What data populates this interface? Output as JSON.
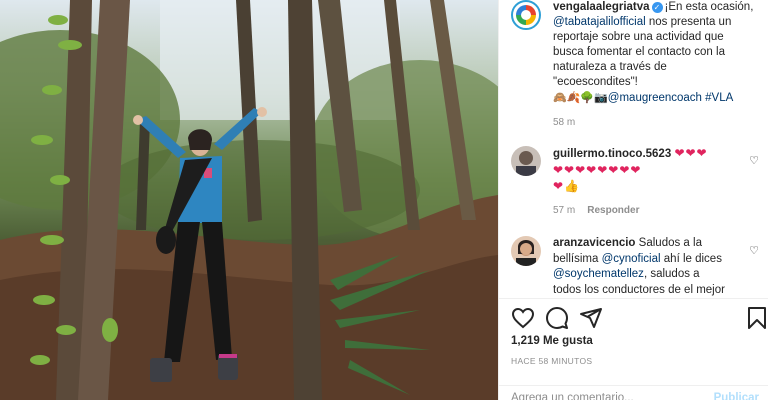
{
  "post": {
    "username": "vengalaalegriatva",
    "caption_lines": [
      "¡En esta ocasión,",
      "nos presenta un",
      "reportaje sobre una actividad que",
      "busca fomentar el contacto con la",
      "naturaleza a través de",
      "\"ecoescondites\"!"
    ],
    "caption_mention": "@tabatajalilofficial",
    "caption_emojis": "🙈🍂🌳📷",
    "caption_tail_mention": "@maugreencoach",
    "caption_hashtag": "#VLA",
    "caption_time": "58 m"
  },
  "comments": [
    {
      "username": "guillermo.tinoco.5623",
      "hearts_line1": "❤❤❤",
      "hearts_line2": "❤❤❤❤❤❤❤❤",
      "hearts_line3": "❤👍",
      "time": "57 m",
      "reply_label": "Responder"
    },
    {
      "username": "aranzavicencio",
      "text_line1": "Saludos a la",
      "text_line2_pre": "bellísima",
      "mention1": "@cynoficial",
      "text_line2_post": "ahí le dices",
      "mention2": "@soychematellez",
      "text_line3_post": ", saludos a",
      "text_line4": "todos los conductores de el mejor"
    }
  ],
  "actions": {
    "likes": "1,219 Me gusta",
    "posted": "HACE 58 MINUTOS",
    "comment_placeholder": "Agrega un comentario...",
    "post_label": "Publicar"
  },
  "colors": {
    "accent_link": "#00376b",
    "verified": "#3897f0",
    "heart": "#e0245e",
    "post_button_disabled": "#b2dffc"
  },
  "icons": [
    "heart-icon",
    "comment-icon",
    "share-icon",
    "bookmark-icon",
    "verified-icon"
  ]
}
